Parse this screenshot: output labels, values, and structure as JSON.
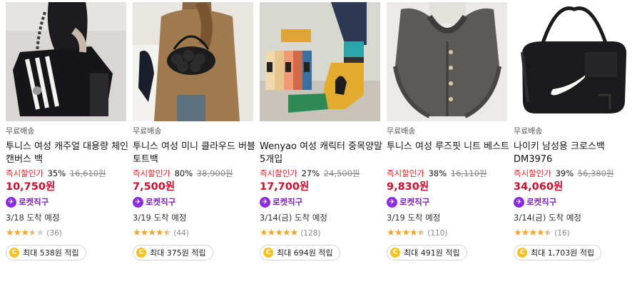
{
  "products": [
    {
      "shipping": "무료배송",
      "name": "투니스 여성 캐주얼 대용량 체인 캔버스 백",
      "discount_label": "즉시할인가",
      "discount_pct": "35%",
      "original_price": "16,610원",
      "price": "10,750원",
      "rocket_label": "로켓직구",
      "arrival": "3/18 도착 예정",
      "rating": 3.5,
      "review_count": "(36)",
      "reward": "최대 538원 적립",
      "image_icon": "black-chain-bag-photo"
    },
    {
      "shipping": "무료배송",
      "name": "투니스 여성 미니 클라우드 버블 토트백",
      "discount_label": "즉시할인가",
      "discount_pct": "80%",
      "original_price": "38,900원",
      "price": "7,500원",
      "rocket_label": "로켓직구",
      "arrival": "3/19 도착 예정",
      "rating": 4.5,
      "review_count": "(44)",
      "reward": "최대 375원 적립",
      "image_icon": "puffer-tote-bag-photo"
    },
    {
      "shipping": "",
      "name": "Wenyao 여성 캐릭터 중목양말 5개입",
      "discount_label": "즉시할인가",
      "discount_pct": "27%",
      "original_price": "24,500원",
      "price": "17,700원",
      "rocket_label": "로켓직구",
      "arrival": "3/14(금) 도착 예정",
      "rating": 5,
      "review_count": "(128)",
      "reward": "최대 694원 적립",
      "image_icon": "character-socks-photo"
    },
    {
      "shipping": "무료배송",
      "name": "투니스 여성 루즈핏 니트 베스트",
      "discount_label": "즉시할인가",
      "discount_pct": "38%",
      "original_price": "16,110원",
      "price": "9,830원",
      "rocket_label": "로켓직구",
      "arrival": "3/19 도착 예정",
      "rating": 4.5,
      "review_count": "(110)",
      "reward": "최대 491원 적립",
      "image_icon": "knit-vest-photo"
    },
    {
      "shipping": "무료배송",
      "name": "나이키 남성용 크로스백 DM3976",
      "discount_label": "즉시할인가",
      "discount_pct": "39%",
      "original_price": "56,380원",
      "price": "34,060원",
      "rocket_label": "로켓직구",
      "arrival": "3/14(금) 도착 예정",
      "rating": 4.5,
      "review_count": "(16)",
      "reward": "최대 1,703원 적립",
      "image_icon": "nike-duffel-bag-photo"
    }
  ],
  "colors": {
    "discount_label": "#e52528",
    "price": "#c8102e",
    "rocket": "#7b22c9",
    "star": "#f5a623",
    "coin": "#f8c21c"
  }
}
